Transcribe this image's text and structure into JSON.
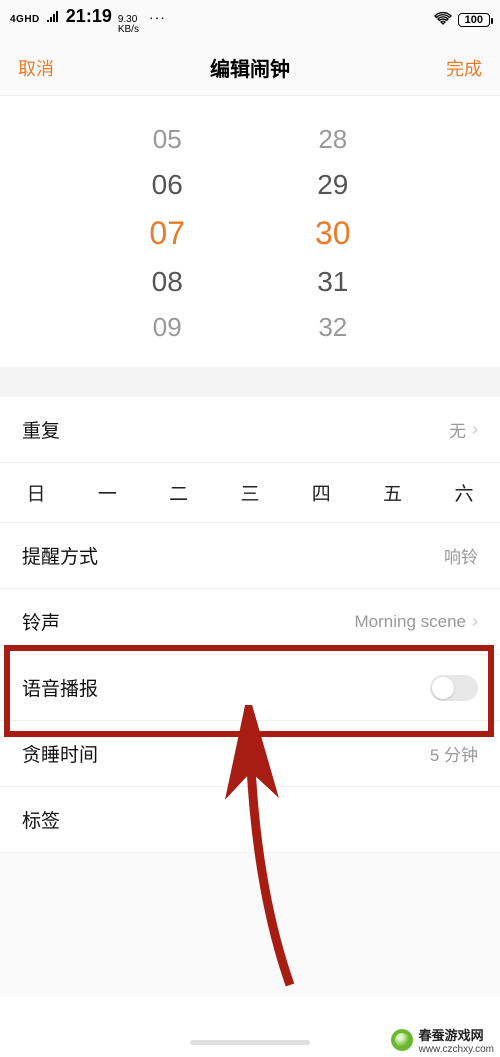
{
  "statusbar": {
    "net_label": "4GHD",
    "time": "21:19",
    "speed_top": "9.30",
    "speed_bot": "KB/s",
    "dots": "···",
    "battery": "100"
  },
  "header": {
    "cancel": "取消",
    "title": "编辑闹钟",
    "done": "完成"
  },
  "picker": {
    "hours": [
      "05",
      "06",
      "07",
      "08",
      "09"
    ],
    "minutes": [
      "28",
      "29",
      "30",
      "31",
      "32"
    ],
    "selected_hour": "07",
    "selected_minute": "30"
  },
  "repeat_row": {
    "label": "重复",
    "value": "无"
  },
  "weekdays": [
    "日",
    "一",
    "二",
    "三",
    "四",
    "五",
    "六"
  ],
  "alert_row": {
    "label": "提醒方式",
    "value": "响铃"
  },
  "ringtone_row": {
    "label": "铃声",
    "value": "Morning scene"
  },
  "voice_row": {
    "label": "语音播报"
  },
  "snooze_row": {
    "label": "贪睡时间",
    "value": "5 分钟"
  },
  "tag_row": {
    "label": "标签"
  },
  "watermark": {
    "name": "春蚕游戏网",
    "url": "www.czchxy.com"
  },
  "colors": {
    "accent": "#e97c2a",
    "annot": "#a71c13"
  }
}
